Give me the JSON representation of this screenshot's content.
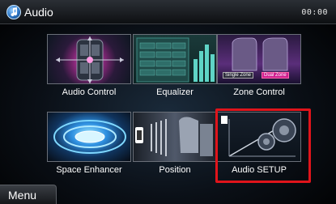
{
  "header": {
    "title": "Audio",
    "clock": "00:00"
  },
  "tiles": [
    {
      "label": "Audio Control"
    },
    {
      "label": "Equalizer"
    },
    {
      "label": "Zone Control",
      "buttons": [
        "Single Zone",
        "Dual Zone"
      ]
    },
    {
      "label": "Space Enhancer"
    },
    {
      "label": "Position"
    },
    {
      "label": "Audio SETUP",
      "highlighted": true
    }
  ],
  "footer": {
    "menu_label": "Menu"
  },
  "colors": {
    "highlight": "#e0141b",
    "dual_zone": "#d02090"
  }
}
